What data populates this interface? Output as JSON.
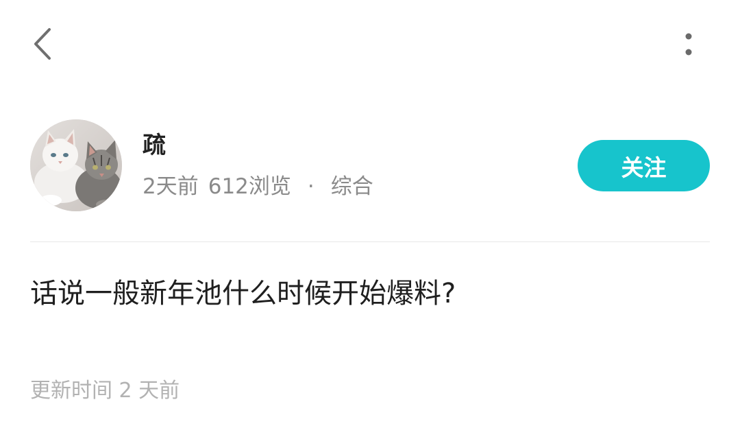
{
  "header": {
    "back_icon": "chevron-left-icon",
    "more_icon": "more-vertical-icon"
  },
  "author": {
    "name": "疏",
    "time_ago": "2天前",
    "views": "612浏览",
    "separator": "·",
    "category": "综合",
    "avatar": "cats-avatar"
  },
  "follow": {
    "label": "关注",
    "color": "#17c4cc"
  },
  "post": {
    "title": "话说一般新年池什么时候开始爆料?"
  },
  "footer": {
    "updated": "更新时间 2 天前"
  }
}
